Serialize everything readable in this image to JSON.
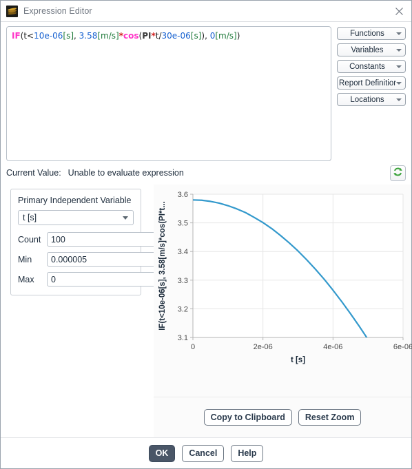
{
  "window": {
    "title": "Expression Editor",
    "app_icon": "layers-icon",
    "close_icon": "close-icon"
  },
  "expression": {
    "full_text": "IF(t<10e-06[s], 3.58[m/s]*cos(PI*t/30e-06[s]), 0[m/s])",
    "tokens": [
      {
        "t": "IF",
        "k": "fn"
      },
      {
        "t": "(t<",
        "k": "plain"
      },
      {
        "t": "10e-06",
        "k": "num"
      },
      {
        "t": "[s]",
        "k": "unit"
      },
      {
        "t": ", ",
        "k": "plain"
      },
      {
        "t": "3.58",
        "k": "num"
      },
      {
        "t": "[m/s]",
        "k": "unit"
      },
      {
        "t": "*",
        "k": "op"
      },
      {
        "t": "cos",
        "k": "fn"
      },
      {
        "t": "(",
        "k": "plain"
      },
      {
        "t": "PI",
        "k": "const"
      },
      {
        "t": "*",
        "k": "op"
      },
      {
        "t": "t/",
        "k": "plain"
      },
      {
        "t": "30e-06",
        "k": "num"
      },
      {
        "t": "[s]",
        "k": "unit"
      },
      {
        "t": "), ",
        "k": "plain"
      },
      {
        "t": "0",
        "k": "num"
      },
      {
        "t": "[m/s]",
        "k": "unit"
      },
      {
        "t": ")",
        "k": "plain"
      }
    ]
  },
  "side_buttons": [
    {
      "label": "Functions",
      "icon": "chevron-down-icon"
    },
    {
      "label": "Variables",
      "icon": "chevron-down-icon"
    },
    {
      "label": "Constants",
      "icon": "chevron-down-icon"
    },
    {
      "label": "Report Definitions",
      "icon": "chevron-down-icon"
    },
    {
      "label": "Locations",
      "icon": "chevron-down-icon"
    }
  ],
  "current_value": {
    "label": "Current Value:",
    "value": "Unable to evaluate expression",
    "refresh_icon": "refresh-icon"
  },
  "parameters": {
    "panel_label": "Primary Independent Variable",
    "variable_select": {
      "value": "t [s]",
      "icon": "chevron-down-icon"
    },
    "fields": [
      {
        "label": "Count",
        "value": "100",
        "type": "spinner"
      },
      {
        "label": "Min",
        "value": "0.000005",
        "type": "text"
      },
      {
        "label": "Max",
        "value": "0",
        "type": "text"
      }
    ]
  },
  "chart_actions": [
    {
      "label": "Copy to Clipboard"
    },
    {
      "label": "Reset Zoom"
    }
  ],
  "footer_buttons": [
    {
      "label": "OK",
      "style": "primary"
    },
    {
      "label": "Cancel",
      "style": "standard"
    },
    {
      "label": "Help",
      "style": "standard"
    }
  ],
  "chart_data": {
    "type": "line",
    "title": "",
    "xlabel": "t [s]",
    "ylabel": "IF(t<10e-06[s], 3.58[m/s]*cos(PI*t...",
    "ylabel_full": "IF(t<10e-06[s], 3.58[m/s]*cos(PI*t/30e-06[s]), 0[m/s])",
    "xlim": [
      0,
      6e-06
    ],
    "ylim": [
      3.1,
      3.6
    ],
    "xticks": [
      0,
      2e-06,
      4e-06,
      6e-06
    ],
    "xtick_labels": [
      "0",
      "2e-06",
      "4e-06",
      "6e-06"
    ],
    "yticks": [
      3.1,
      3.2,
      3.3,
      3.4,
      3.5,
      3.6
    ],
    "ytick_labels": [
      "3.1",
      "3.2",
      "3.3",
      "3.4",
      "3.5",
      "3.6"
    ],
    "grid": true,
    "legend": "none",
    "line_color": "#3399cc",
    "line_width": 2.2,
    "series": [
      {
        "name": "IF(t<10e-06[s], 3.58[m/s]*cos(PI*t/30e-06[s]), 0[m/s])",
        "x": [
          0.0,
          2.5e-07,
          5e-07,
          7.5e-07,
          1e-06,
          1.25e-06,
          1.5e-06,
          1.75e-06,
          2e-06,
          2.25e-06,
          2.5e-06,
          2.75e-06,
          3e-06,
          3.25e-06,
          3.5e-06,
          3.75e-06,
          4e-06,
          4.25e-06,
          4.5e-06,
          4.75e-06,
          5e-06
        ],
        "y": [
          3.58,
          3.579,
          3.575,
          3.569,
          3.56,
          3.549,
          3.536,
          3.519,
          3.501,
          3.48,
          3.456,
          3.43,
          3.402,
          3.371,
          3.338,
          3.303,
          3.265,
          3.225,
          3.183,
          3.139,
          3.093
        ]
      }
    ]
  }
}
